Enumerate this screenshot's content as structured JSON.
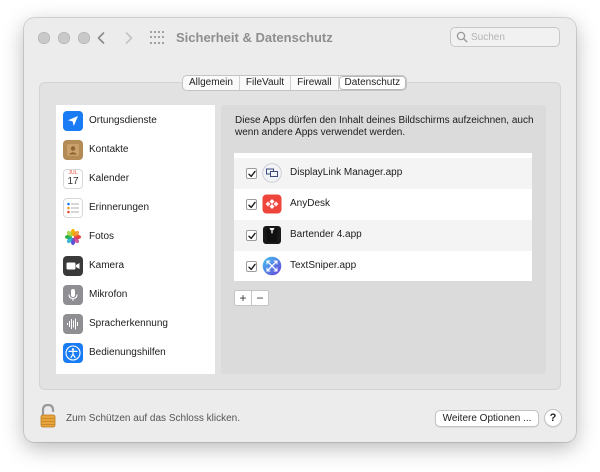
{
  "window": {
    "title": "Sicherheit & Datenschutz",
    "search_placeholder": "Suchen"
  },
  "tabs": [
    {
      "label": "Allgemein",
      "active": false
    },
    {
      "label": "FileVault",
      "active": false
    },
    {
      "label": "Firewall",
      "active": false
    },
    {
      "label": "Datenschutz",
      "active": true
    }
  ],
  "sidebar": {
    "items": [
      {
        "label": "Ortungsdienste",
        "icon": "location-arrow-icon",
        "selected": false
      },
      {
        "label": "Kontakte",
        "icon": "contacts-book-icon",
        "selected": false
      },
      {
        "label": "Kalender",
        "icon": "calendar-icon",
        "selected": false,
        "icon_month": "JUL",
        "icon_day": "17"
      },
      {
        "label": "Erinnerungen",
        "icon": "reminders-list-icon",
        "selected": false
      },
      {
        "label": "Fotos",
        "icon": "photos-flower-icon",
        "selected": false
      },
      {
        "label": "Kamera",
        "icon": "camera-icon",
        "selected": false
      },
      {
        "label": "Mikrofon",
        "icon": "microphone-icon",
        "selected": false
      },
      {
        "label": "Spracherkennung",
        "icon": "speech-waveform-icon",
        "selected": false
      },
      {
        "label": "Bedienungshilfen",
        "icon": "accessibility-icon",
        "selected": false
      }
    ]
  },
  "content": {
    "description": "Diese Apps dürfen den Inhalt deines Bildschirms aufzeichnen, auch wenn andere Apps verwendet werden.",
    "apps": [
      {
        "name": "DisplayLink Manager.app",
        "checked": true,
        "icon": "displaylink-icon"
      },
      {
        "name": "AnyDesk",
        "checked": true,
        "icon": "anydesk-icon"
      },
      {
        "name": "Bartender 4.app",
        "checked": true,
        "icon": "bartender-tuxedo-icon"
      },
      {
        "name": "TextSniper.app",
        "checked": true,
        "icon": "textsniper-icon"
      }
    ],
    "add_label": "+",
    "remove_label": "−"
  },
  "footer": {
    "lock_label": "Zum Schützen auf das Schloss klicken.",
    "more_options_label": "Weitere Optionen ...",
    "help_label": "?"
  },
  "colors": {
    "accent_blue": "#1a7cf5",
    "anydesk_red": "#ef443b",
    "textsniper_purple": "#5b5ce0"
  }
}
